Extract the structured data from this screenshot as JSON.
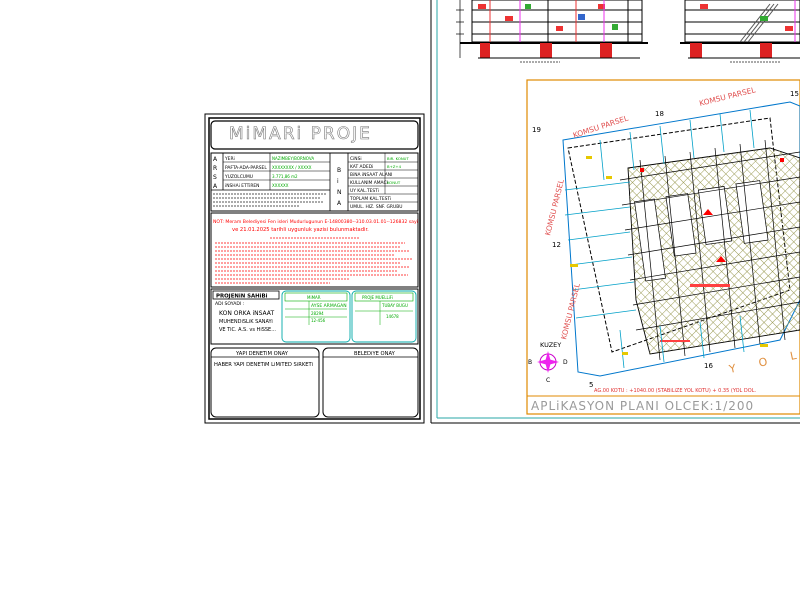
{
  "title_sheet": {
    "heading": "MiMARi     PROJE",
    "side_letters": [
      "A",
      "R",
      "S",
      "A"
    ],
    "info_rows": [
      {
        "label": "YERi",
        "value": "NAZIMBEY/BORNOVA"
      },
      {
        "label": "PAFTA-ADA-PARSEL",
        "value": "XXXXXXXX / XXXXX"
      },
      {
        "label": "YUZOLCUMU",
        "value": "3.771,86 m2"
      },
      {
        "label": "iNSHAi ETTiREN",
        "value": "XXXXXX"
      }
    ],
    "bina_letters": [
      "B",
      "i",
      "N",
      "A"
    ],
    "bina_rows": [
      {
        "label": "CiNSi",
        "value": "BiR. KONUT"
      },
      {
        "label": "KAT ADEDi",
        "value": "B+Z+4"
      },
      {
        "label": "BiNA iNSAAT ALANI",
        "value": ""
      },
      {
        "label": "KULLANIM AMACI",
        "value": "KONUT"
      },
      {
        "label": "UY KAL.TESTi",
        "value": ""
      },
      {
        "label": "TOPLAM KAL.TESTi",
        "value": ""
      },
      {
        "label": "UMUL. HIZ. SNF. GRUBU",
        "value": ""
      }
    ],
    "note_line_1": "NOT: Meram Belediyesi Fen isleri Mudurlugunun E-14800380--310.03.01.01--126832 sayi",
    "note_line_2": "ve 21.01.2025 tarihli uygunluk yazisi bulunmaktadir.",
    "proje_sahibi_label": "PROJENiN SAHiBi",
    "adi_soyadi_label": "ADI SOYADI :",
    "company_lines": [
      "KON ORKA iNSAAT",
      "MUHENDiSLiK SANAYi",
      "VE TiC. A.S. vs HiSSE..."
    ],
    "engineer_header": "MiMAR",
    "engineer_name": "AYSE ARMAGAN",
    "engineer_values": [
      "28294",
      "12-456"
    ],
    "right_header": "PROJE MUELLiFi",
    "right_value": "TUBAY BUGU",
    "right_value_2": "14678",
    "yapi_denetim_label": "YAPI DENETiM ONAY",
    "belediye_label": "BELEDiYE ONAY",
    "firm_name": "HABER YAPI DENETiM LiMiTED SiRKETi"
  },
  "site_plan": {
    "labels_parsel": [
      "KOMSU PARSEL",
      "KOMSU PARSEL",
      "KOMSU PARSEL",
      "KOMSU PARSEL"
    ],
    "corner_numbers": [
      "19",
      "18",
      "15",
      "12",
      "16",
      "5"
    ],
    "north_label": "KUZEY",
    "compass": [
      "B",
      "D",
      "C"
    ],
    "road_label": "Y O L",
    "level_note": "AG.00 KOTU : +1040.00 (STABiLiZE YOL KOTU) + 0.35 (YOL DOL.",
    "title": "APLiKASYON   PLANI    OLCEK:1/200"
  },
  "colors": {
    "frame": "#000000",
    "accent_red": "#ff0000",
    "accent_green": "#00cc00",
    "accent_cyan": "#00bcbc",
    "accent_orange": "#e67300",
    "accent_yellow": "#e6d200",
    "hatch": "#8c8c40"
  }
}
